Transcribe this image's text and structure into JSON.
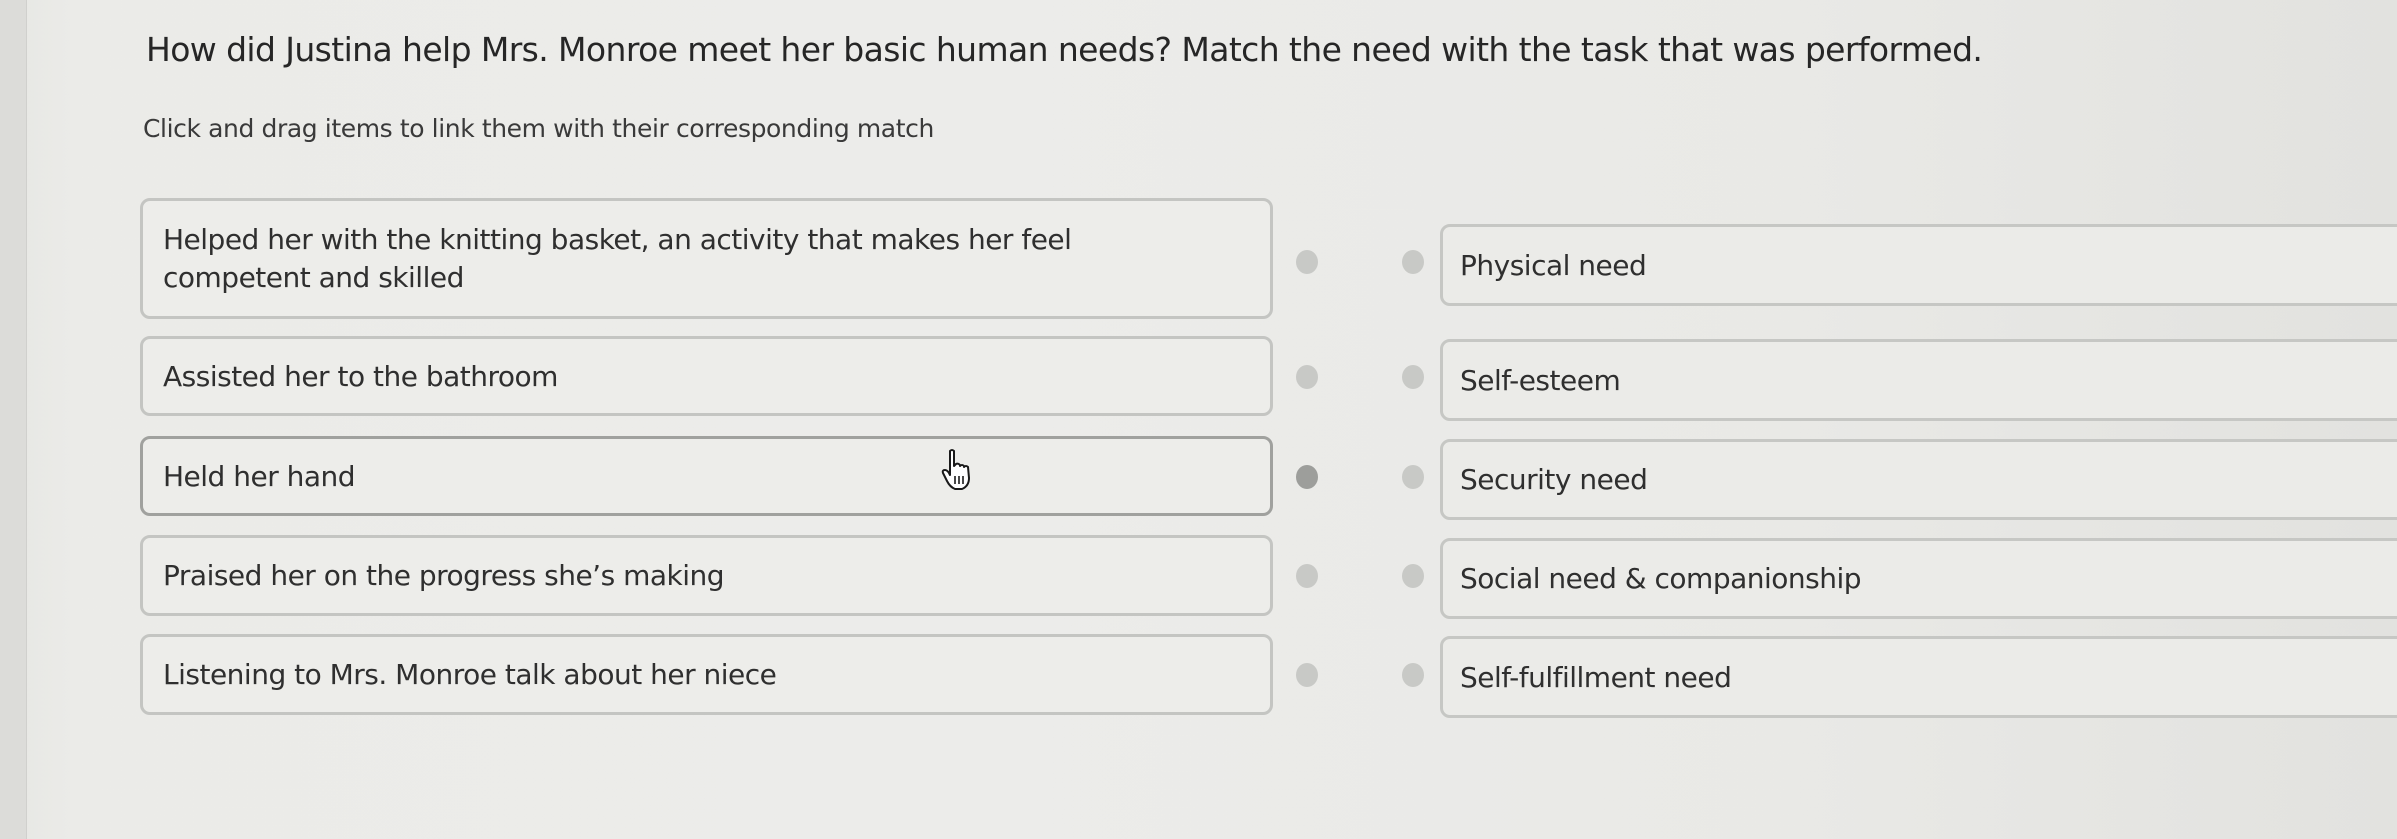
{
  "question": {
    "title": "How did Justina help Mrs. Monroe meet her basic human needs? Match the need with the task that was performed.",
    "instructions": "Click and drag items to link them with their corresponding match"
  },
  "tasks": [
    {
      "label": "Helped her with the knitting basket, an activity that makes her feel competent and skilled"
    },
    {
      "label": "Assisted her to the bathroom"
    },
    {
      "label": "Held her hand",
      "active": true
    },
    {
      "label": "Praised her on the progress she’s making"
    },
    {
      "label": "Listening to Mrs. Monroe talk about her niece"
    }
  ],
  "needs": [
    {
      "label": "Physical need"
    },
    {
      "label": "Self-esteem"
    },
    {
      "label": "Security need"
    },
    {
      "label": "Social need & companionship"
    },
    {
      "label": "Self-fulfillment need"
    }
  ],
  "cursor": {
    "icon": "hand-pointer-icon"
  },
  "colors": {
    "background": "#ebebe8",
    "border": "#c4c5c2",
    "dot": "#c8c9c6",
    "dot_active": "#9d9e9b",
    "text": "#2b2b2b"
  }
}
